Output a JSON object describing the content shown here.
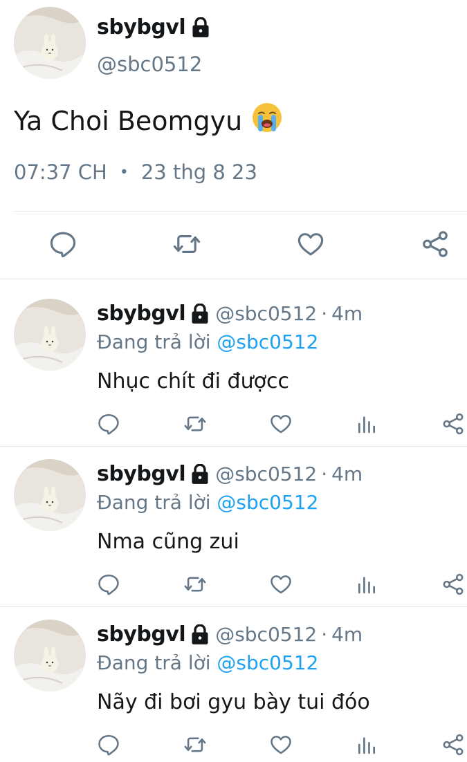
{
  "main_tweet": {
    "display_name": "sbybgvl",
    "handle": "@sbc0512",
    "text": "Ya Choi Beomgyu",
    "emoji": "😭",
    "time": "07:37 CH",
    "dot": "•",
    "date": "23 thg 8 23",
    "icons": [
      "reply-icon",
      "retweet-icon",
      "like-icon",
      "share-icon"
    ]
  },
  "replies": [
    {
      "display_name": "sbybgvl",
      "handle": "@sbc0512",
      "separator": "·",
      "time": "4m",
      "replying_prefix": "Đang trả lời ",
      "replying_to": "@sbc0512",
      "text": "Nhục chít đi đượcc"
    },
    {
      "display_name": "sbybgvl",
      "handle": "@sbc0512",
      "separator": "·",
      "time": "4m",
      "replying_prefix": "Đang trả lời ",
      "replying_to": "@sbc0512",
      "text": "Nma cũng zui"
    },
    {
      "display_name": "sbybgvl",
      "handle": "@sbc0512",
      "separator": "·",
      "time": "4m",
      "replying_prefix": "Đang trả lời ",
      "replying_to": "@sbc0512",
      "text": "Nãy đi bơi gyu bày tui đóo"
    }
  ],
  "colors": {
    "text": "#14171a",
    "secondary": "#657786",
    "accent": "#1da1f2",
    "divider": "#e1e8ed"
  }
}
